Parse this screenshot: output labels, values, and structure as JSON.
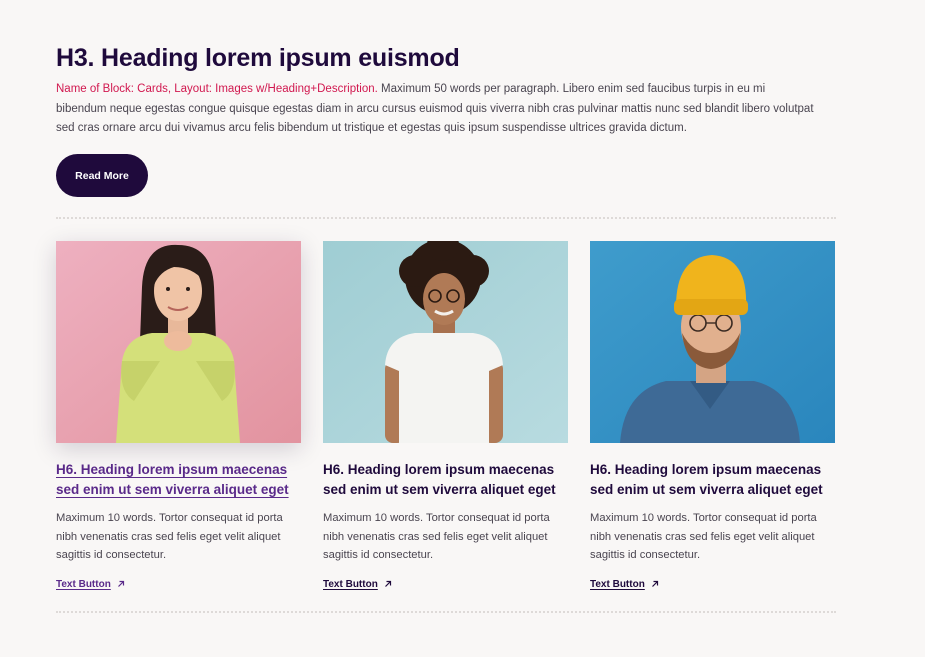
{
  "section": {
    "heading": "H3. Heading lorem ipsum euismod",
    "intro_block_name": "Name of Block: Cards, Layout: Images w/Heading+Description.",
    "intro_text": " Maximum 50 words per paragraph. Libero enim sed faucibus turpis in eu mi bibendum neque egestas congue quisque egestas diam in arcu cursus euismod quis viverra nibh cras pulvinar mattis nunc sed blandit libero volutpat sed cras ornare arcu dui vivamus arcu felis bibendum ut tristique et egestas quis ipsum suspendisse ultrices gravida dictum.",
    "read_more_label": "Read More"
  },
  "cards": [
    {
      "image": "woman-in-green-sweater-on-pink-background",
      "title": "H6. Heading lorem ipsum maecenas sed enim ut sem viverra aliquet eget",
      "description": "Maximum 10 words. Tortor consequat id porta nibh venenatis cras sed felis eget velit aliquet sagittis id consectetur.",
      "button_label": "Text Button",
      "button_icon": "arrow-up-right-icon"
    },
    {
      "image": "woman-in-white-tshirt-on-teal-background",
      "title": "H6. Heading lorem ipsum maecenas sed enim ut sem viverra aliquet eget",
      "description": "Maximum 10 words. Tortor consequat id porta nibh venenatis cras sed felis eget velit aliquet sagittis id consectetur.",
      "button_label": "Text Button",
      "button_icon": "arrow-up-right-icon"
    },
    {
      "image": "man-in-yellow-beanie-on-blue-background",
      "title": "H6. Heading lorem ipsum maecenas sed enim ut sem viverra aliquet eget",
      "description": "Maximum 10 words. Tortor consequat id porta nibh venenatis cras sed felis eget velit aliquet sagittis id consectetur.",
      "button_label": "Text Button",
      "button_icon": "arrow-up-right-icon"
    }
  ],
  "colors": {
    "background": "#f9f7f6",
    "primary": "#1f0a3c",
    "accent_pink": "#d1184f",
    "hover_purple": "#5a2a8a",
    "body_text": "#4a4550"
  }
}
